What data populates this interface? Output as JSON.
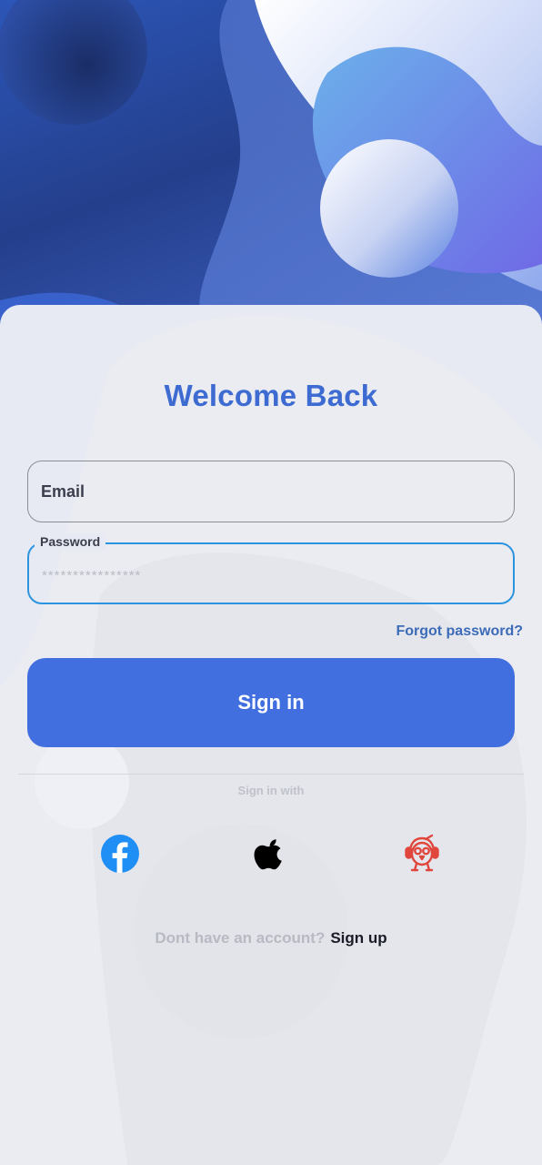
{
  "header": {
    "image": "abstract-blue-shapes"
  },
  "login": {
    "title": "Welcome Back",
    "email_placeholder": "Email",
    "password_label": "Password",
    "password_value": "****************",
    "forgot_password": "Forgot password?",
    "sign_in_button": "Sign in",
    "sign_in_with": "Sign in with"
  },
  "social": [
    {
      "name": "facebook",
      "icon": "facebook-icon",
      "color": "#1f8ff5"
    },
    {
      "name": "apple",
      "icon": "apple-icon",
      "color": "#000000"
    },
    {
      "name": "robot",
      "icon": "robot-icon",
      "color": "#e0463c"
    }
  ],
  "footer": {
    "question": "Dont have an account?",
    "sign_up": "Sign up"
  },
  "colors": {
    "accent": "#426fdf",
    "title": "#3d6bd1",
    "focus_border": "#2c94de",
    "link": "#3c6bb8"
  }
}
